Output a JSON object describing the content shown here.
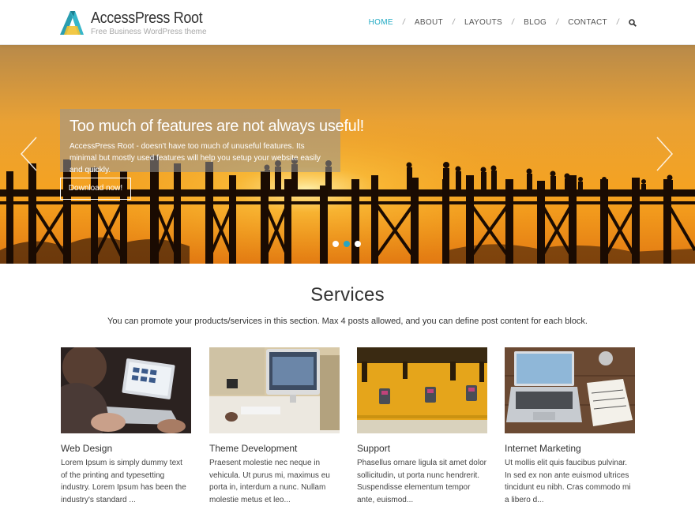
{
  "brand": {
    "title": "AccessPress Root",
    "tagline": "Free Business WordPress theme",
    "accent": "#1fa9c3"
  },
  "nav": {
    "items": [
      {
        "label": "HOME",
        "active": true
      },
      {
        "label": "ABOUT"
      },
      {
        "label": "LAYOUTS"
      },
      {
        "label": "BLOG"
      },
      {
        "label": "CONTACT"
      }
    ],
    "separator": "/",
    "search_icon": "search-icon"
  },
  "slider": {
    "title": "Too much of features are not always useful!",
    "text": "AccessPress Root - doesn't have too much of unuseful features. Its minimal but mostly used features will help you setup your website easily and quickly.",
    "button": "Download now!",
    "slides": 3,
    "active_slide": 2,
    "dot_active_color": "#29a5c0"
  },
  "services": {
    "title": "Services",
    "description": "You can promote your products/services in this section. Max 4 posts allowed, and you can define post content for each block.",
    "items": [
      {
        "title": "Web Design",
        "text": "Lorem Ipsum is simply dummy text of the printing and typesetting industry. Lorem Ipsum has been the industry's standard ..."
      },
      {
        "title": "Theme Development",
        "text": "Praesent molestie nec neque in vehicula. Ut purus mi, maximus eu porta in, interdum a nunc. Nullam molestie metus et leo..."
      },
      {
        "title": "Support",
        "text": "Phasellus ornare ligula sit amet dolor sollicitudin, ut porta nunc hendrerit. Suspendisse elementum tempor ante, euismod..."
      },
      {
        "title": "Internet Marketing",
        "text": "Ut mollis elit quis faucibus pulvinar. In sed ex non ante euismod ultrices tincidunt eu nibh. Cras commodo mi a libero d..."
      }
    ]
  }
}
